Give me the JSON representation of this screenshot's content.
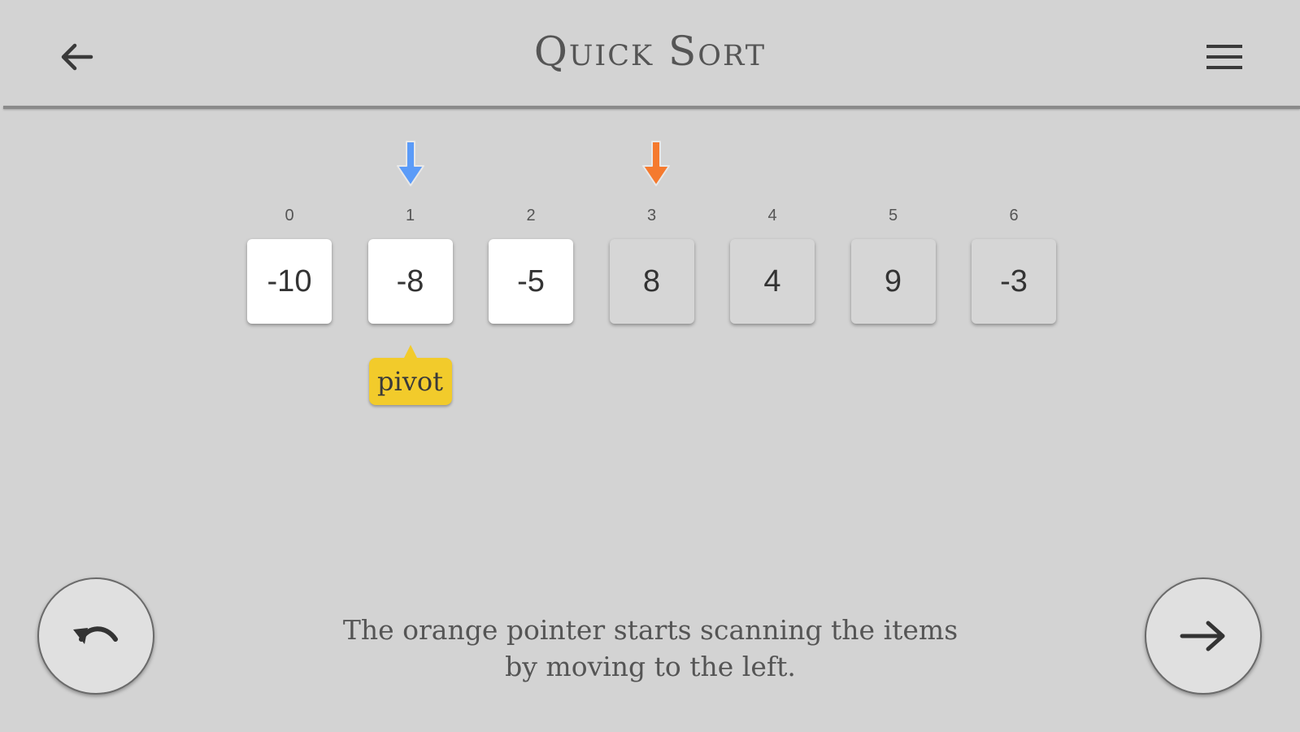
{
  "header": {
    "title": "Quick Sort",
    "back_icon": "arrow-left-icon",
    "menu_icon": "hamburger-menu-icon"
  },
  "array": {
    "indices": [
      "0",
      "1",
      "2",
      "3",
      "4",
      "5",
      "6"
    ],
    "values": [
      "-10",
      "-8",
      "-5",
      "8",
      "4",
      "9",
      "-3"
    ],
    "active": [
      true,
      true,
      true,
      false,
      false,
      false,
      false
    ]
  },
  "pointers": {
    "blue": {
      "index": 1,
      "color": "#5b9bf8"
    },
    "orange": {
      "index": 3,
      "color": "#f57a2e"
    }
  },
  "pivot": {
    "label": "pivot",
    "index": 1,
    "color": "#f2cb2b"
  },
  "controls": {
    "undo_icon": "undo-icon",
    "next_icon": "arrow-right-icon"
  },
  "message": {
    "line1": "The orange pointer starts scanning the items",
    "line2": "by moving to the left."
  }
}
